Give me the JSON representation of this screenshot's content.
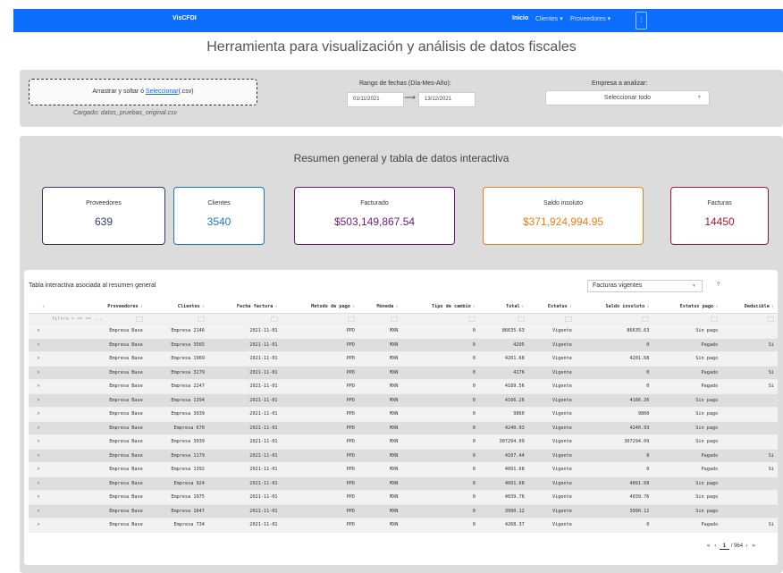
{
  "navbar": {
    "brand": "VisCFDI",
    "links": [
      "Inicio",
      "Clientes ▾",
      "Proveedores ▾"
    ]
  },
  "page_title": "Herramienta para visualización y análisis de datos fiscales",
  "upload": {
    "prompt_prefix": "Arrastrar y soltar ó ",
    "link": "Seleccionar",
    "prompt_suffix": "(.csv)",
    "loaded": "Cargado: datos_pruebas_original.csv"
  },
  "dates": {
    "label": "Rango de fechas (Día-Mes-Año):",
    "start": "01/11/2021",
    "end": "13/12/2021"
  },
  "company": {
    "label": "Empresa a analizar:",
    "selected": "Seleccionar todo"
  },
  "summary": {
    "title": "Resumen general y tabla de datos interactiva",
    "cards": [
      {
        "label": "Proveedores",
        "value": "639",
        "color": "#2c3e66"
      },
      {
        "label": "Clientes",
        "value": "3540",
        "color": "#1f77b4"
      },
      {
        "label": "Facturado",
        "value": "$503,149,867.54",
        "color": "#6a1b7a"
      },
      {
        "label": "Saldo insoluto",
        "value": "$371,924,994.95",
        "color": "#e67e22"
      },
      {
        "label": "Facturas",
        "value": "14450",
        "color": "#a31b2b"
      }
    ]
  },
  "table": {
    "title": "Tabla interactiva asociada al resumen general",
    "filter_select": "Facturas vigentes",
    "help": "?",
    "filter_placeholder": "filtro > <= >= ...",
    "columns": [
      "",
      "Proveedores",
      "Clientes",
      "Fecha factura",
      "Metodo de pago",
      "Moneda",
      "Tipo de cambio",
      "Total",
      "Estatus",
      "Saldo insoluto",
      "Estatus pago",
      "Deducible"
    ],
    "rows": [
      [
        "×",
        "Empresa Base",
        "Empresa 2146",
        "2021-11-01",
        "PPD",
        "MXN",
        "0",
        "86635.63",
        "Vigente",
        "86635.63",
        "Sin pago",
        ""
      ],
      [
        "×",
        "Empresa Base",
        "Empresa 3565",
        "2021-11-01",
        "PPD",
        "MXN",
        "0",
        "4205",
        "Vigente",
        "0",
        "Pagado",
        "Si"
      ],
      [
        "×",
        "Empresa Base",
        "Empresa 1969",
        "2021-11-01",
        "PPD",
        "MXN",
        "0",
        "4201.68",
        "Vigente",
        "4201.68",
        "Sin pago",
        ""
      ],
      [
        "×",
        "Empresa Base",
        "Empresa 3279",
        "2021-11-01",
        "PPD",
        "MXN",
        "0",
        "4176",
        "Vigente",
        "0",
        "Pagado",
        "Si"
      ],
      [
        "×",
        "Empresa Base",
        "Empresa 2247",
        "2021-11-01",
        "PPD",
        "MXN",
        "0",
        "4189.56",
        "Vigente",
        "0",
        "Pagado",
        "Si"
      ],
      [
        "×",
        "Empresa Base",
        "Empresa 1394",
        "2021-11-01",
        "PPD",
        "MXN",
        "0",
        "4166.26",
        "Vigente",
        "4166.26",
        "Sin pago",
        ""
      ],
      [
        "×",
        "Empresa Base",
        "Empresa 3939",
        "2021-11-01",
        "PPD",
        "MXN",
        "0",
        "9860",
        "Vigente",
        "9860",
        "Sin pago",
        ""
      ],
      [
        "×",
        "Empresa Base",
        "Empresa 670",
        "2021-11-01",
        "PPD",
        "MXN",
        "0",
        "4240.93",
        "Vigente",
        "4240.93",
        "Sin pago",
        ""
      ],
      [
        "×",
        "Empresa Base",
        "Empresa 3939",
        "2021-11-01",
        "PPD",
        "MXN",
        "0",
        "307294.09",
        "Vigente",
        "307294.09",
        "Sin pago",
        ""
      ],
      [
        "×",
        "Empresa Base",
        "Empresa 1179",
        "2021-11-01",
        "PPD",
        "MXN",
        "0",
        "4107.44",
        "Vigente",
        "0",
        "Pagado",
        "Si"
      ],
      [
        "×",
        "Empresa Base",
        "Empresa 1392",
        "2021-11-01",
        "PPD",
        "MXN",
        "0",
        "4091.68",
        "Vigente",
        "0",
        "Pagado",
        "Si"
      ],
      [
        "×",
        "Empresa Base",
        "Empresa 924",
        "2021-11-01",
        "PPD",
        "MXN",
        "0",
        "4091.68",
        "Vigente",
        "4091.68",
        "Sin pago",
        ""
      ],
      [
        "×",
        "Empresa Base",
        "Empresa 1975",
        "2021-11-01",
        "PPD",
        "MXN",
        "0",
        "4039.76",
        "Vigente",
        "4039.76",
        "Sin pago",
        ""
      ],
      [
        "×",
        "Empresa Base",
        "Empresa 1647",
        "2021-11-01",
        "PPD",
        "MXN",
        "0",
        "3990.12",
        "Vigente",
        "3990.12",
        "Sin pago",
        ""
      ],
      [
        "×",
        "Empresa Base",
        "Empresa 734",
        "2021-11-01",
        "PPD",
        "MXN",
        "0",
        "4268.37",
        "Vigente",
        "0",
        "Pagado",
        "Si"
      ]
    ]
  },
  "pager": {
    "first": "«",
    "prev": "‹",
    "page": "1",
    "sep": "/",
    "total": "964",
    "next": "›",
    "last": "»"
  },
  "colors": {
    "navbar": "#0d6efd",
    "panel": "#dcdcdc"
  }
}
